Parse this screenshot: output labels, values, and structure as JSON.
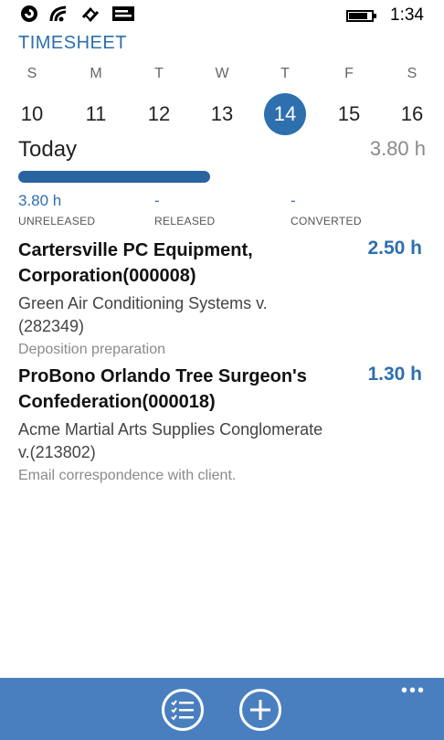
{
  "status_bar": {
    "icons": [
      "notification-icon",
      "wifi-icon",
      "data-connection-icon",
      "message-icon"
    ],
    "battery_level": 0.85,
    "time": "1:34"
  },
  "app": {
    "title": "TIMESHEET"
  },
  "week": {
    "days": [
      {
        "dow": "S",
        "date": "10"
      },
      {
        "dow": "M",
        "date": "11"
      },
      {
        "dow": "T",
        "date": "12"
      },
      {
        "dow": "W",
        "date": "13"
      },
      {
        "dow": "T",
        "date": "14",
        "selected": true
      },
      {
        "dow": "F",
        "date": "15"
      },
      {
        "dow": "S",
        "date": "16"
      }
    ]
  },
  "summary": {
    "label": "Today",
    "total": "3.80 h",
    "progress": 1.0,
    "stats": [
      {
        "value": "3.80 h",
        "label": "UNRELEASED"
      },
      {
        "value": "-",
        "label": "RELEASED"
      },
      {
        "value": "-",
        "label": "CONVERTED"
      }
    ]
  },
  "entries": [
    {
      "client": "Cartersville PC Equipment, Corporation(000008)",
      "hours": "2.50 h",
      "matter": "Green Air Conditioning Systems v.(282349)",
      "description": "Deposition preparation"
    },
    {
      "client": "ProBono Orlando Tree Surgeon's Confederation(000018)",
      "hours": "1.30 h",
      "matter": "Acme Martial Arts Supplies Conglomerate v.(213802)",
      "description": "Email correspondence with client."
    }
  ],
  "app_bar": {
    "buttons": [
      "list-icon",
      "add-icon"
    ],
    "more": "•••"
  },
  "colors": {
    "accent": "#2e6fae",
    "app_bar": "#4a7fbf",
    "progress": "#2a64a0"
  }
}
